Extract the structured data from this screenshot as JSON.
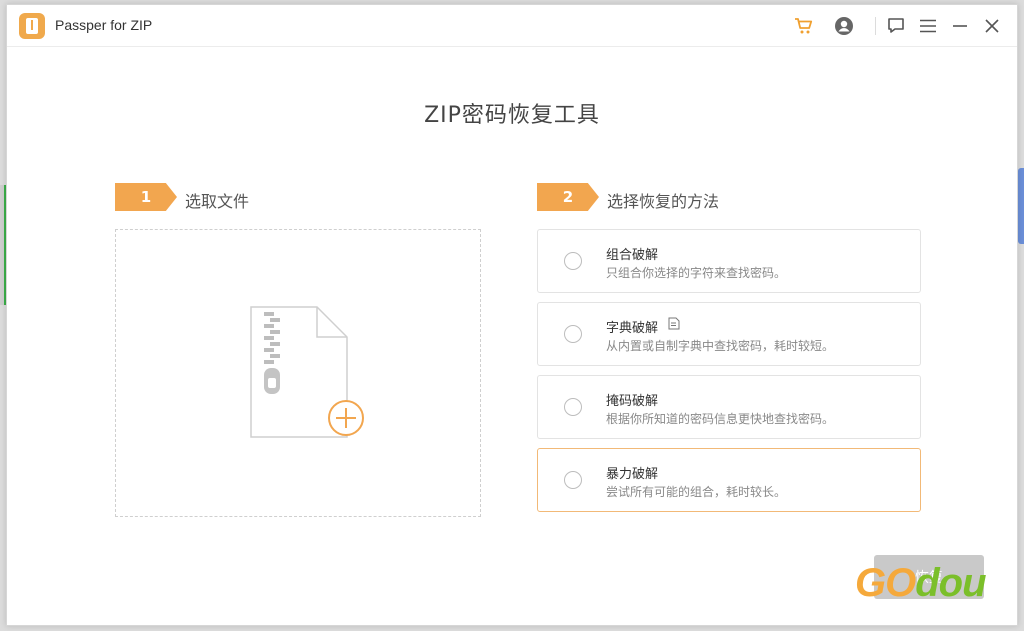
{
  "app": {
    "title": "Passper for ZIP"
  },
  "titlebar": {
    "icons": [
      "cart-icon",
      "account-icon",
      "feedback-icon",
      "menu-icon",
      "minimize-icon",
      "close-icon"
    ]
  },
  "main": {
    "title": "ZIP密码恢复工具",
    "step1": {
      "number": "1",
      "label": "选取文件"
    },
    "step2": {
      "number": "2",
      "label": "选择恢复的方法"
    },
    "methods": [
      {
        "title": "组合破解",
        "desc": "只组合你选择的字符来查找密码。"
      },
      {
        "title": "字典破解",
        "desc": "从内置或自制字典中查找密码，耗时较短。"
      },
      {
        "title": "掩码破解",
        "desc": "根据你所知道的密码信息更快地查找密码。"
      },
      {
        "title": "暴力破解",
        "desc": "尝试所有可能的组合，耗时较长。"
      }
    ],
    "start_label": "恢复"
  },
  "watermark": {
    "part1": "GO",
    "part2": "dou"
  },
  "colors": {
    "accent": "#f2a64f",
    "selected_border": "#f2b977",
    "button_disabled": "#c9c9c9"
  }
}
